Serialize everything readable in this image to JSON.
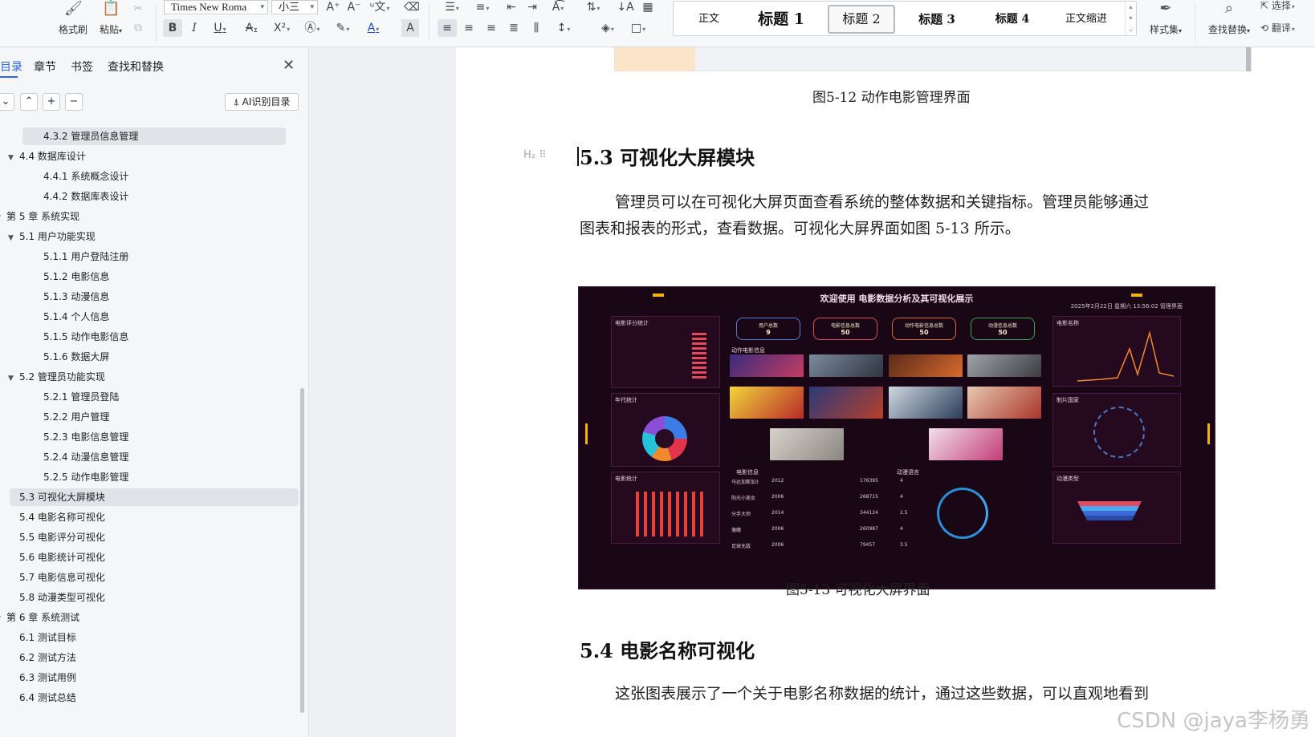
{
  "ribbon": {
    "format_painter": "格式刷",
    "paste": "粘贴",
    "font_name": "Times New Roma",
    "font_size": "小三",
    "styles": [
      "正文",
      "标题 1",
      "标题 2",
      "标题 3",
      "标题 4",
      "正文缩进"
    ],
    "style_set": "样式集",
    "find_replace": "查找替换",
    "select": "选择",
    "translate": "翻译"
  },
  "sidebar": {
    "tabs": [
      "目录",
      "章节",
      "书签",
      "查找和替换"
    ],
    "ai_button": "AI识别目录",
    "toc": [
      {
        "label": "4.3.2 管理员信息管理",
        "level": 3
      },
      {
        "label": "4.4 数据库设计",
        "level": 2
      },
      {
        "label": "4.4.1  系统概念设计",
        "level": 3
      },
      {
        "label": "4.4.2  数据库表设计",
        "level": 3
      },
      {
        "label": "第 5 章  系统实现",
        "level": 1
      },
      {
        "label": "5.1  用户功能实现",
        "level": 2
      },
      {
        "label": "5.1.1  用户登陆注册",
        "level": 3
      },
      {
        "label": "5.1.2  电影信息",
        "level": 3
      },
      {
        "label": "5.1.3  动漫信息",
        "level": 3
      },
      {
        "label": "5.1.4  个人信息",
        "level": 3
      },
      {
        "label": "5.1.5  动作电影信息",
        "level": 3
      },
      {
        "label": "5.1.6  数据大屏",
        "level": 3
      },
      {
        "label": "5.2  管理员功能实现",
        "level": 2
      },
      {
        "label": "5.2.1 管理员登陆",
        "level": 3
      },
      {
        "label": "5.2.2 用户管理",
        "level": 3
      },
      {
        "label": "5.2.3  电影信息管理",
        "level": 3
      },
      {
        "label": "5.2.4  动漫信息管理",
        "level": 3
      },
      {
        "label": "5.2.5  动作电影管理",
        "level": 3
      },
      {
        "label": "5.3  可视化大屏模块",
        "level": 2
      },
      {
        "label": "5.4  电影名称可视化",
        "level": 2
      },
      {
        "label": "5.5  电影评分可视化",
        "level": 2
      },
      {
        "label": "5.6  电影统计可视化",
        "level": 2
      },
      {
        "label": "5.7  电影信息可视化",
        "level": 2
      },
      {
        "label": "5.8  动漫类型可视化",
        "level": 2
      },
      {
        "label": "第 6 章  系统测试",
        "level": 1
      },
      {
        "label": "6.1  测试目标",
        "level": 2
      },
      {
        "label": "6.2  测试方法",
        "level": 2
      },
      {
        "label": "6.3  测试用例",
        "level": 2
      },
      {
        "label": "6.4  测试总结",
        "level": 2
      }
    ]
  },
  "document": {
    "caption_prev": "图5-12  动作电影管理界面",
    "heading_53": "5.3  可视化大屏模块",
    "heading_marker": "H₂ ⠿",
    "para_53_line1": "管理员可以在可视化大屏页面查看系统的整体数据和关键指标。管理员能够通过",
    "para_53_line2": "图表和报表的形式，查看数据。可视化大屏界面如图 5-13 所示。",
    "caption_fig": "图5-13  可视化大屏界面",
    "heading_54": "5.4  电影名称可视化",
    "para_54_line1": "这张图表展示了一个关于电影名称数据的统计，通过这些数据，可以直观地看到",
    "watermark": "CSDN @jaya李杨勇"
  },
  "dashboard": {
    "title": "欢迎使用 电影数据分析及其可视化展示",
    "time": "2025年2月22日 星期六 13:56:02  管理界面",
    "panel_rating": "电影评分统计",
    "panel_years": "年代统计",
    "panel_bars": "电影统计",
    "panel_action": "动作电影信息",
    "panel_info": "电影信息",
    "panel_lang": "动漫语言",
    "panel_names": "电影名称",
    "panel_country": "制片国家",
    "panel_anime": "动漫类型",
    "kpis": [
      {
        "label": "用户总数",
        "value": "9"
      },
      {
        "label": "电影信息总数",
        "value": "50"
      },
      {
        "label": "动作电影信息总数",
        "value": "50"
      },
      {
        "label": "动漫信息总数",
        "value": "50"
      }
    ],
    "rows": [
      [
        "马达加斯加3",
        "2012",
        "176395",
        "4"
      ],
      [
        "阳光小美女",
        "2006",
        "268715",
        "4"
      ],
      [
        "分手大师",
        "2014",
        "344124",
        "2.5"
      ],
      [
        "落魄",
        "2006",
        "260987",
        "4"
      ],
      [
        "足球无敌",
        "2006",
        "79457",
        "3.5"
      ]
    ]
  }
}
